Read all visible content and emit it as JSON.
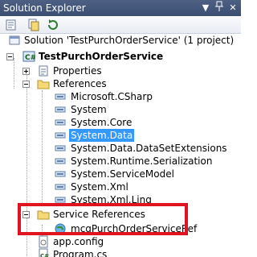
{
  "panel": {
    "title": "Solution Explorer",
    "dropdown_glyph": "▼",
    "pin_glyph": "📌",
    "close_glyph": "✕"
  },
  "toolbar": {
    "buttons": [
      "properties-icon",
      "show-all-files-icon",
      "refresh-icon"
    ]
  },
  "tree": {
    "solution": "Solution 'TestPurchOrderService' (1 project)",
    "project": "TestPurchOrderService",
    "properties": "Properties",
    "references": "References",
    "reference_items": [
      "Microsoft.CSharp",
      "System",
      "System.Core",
      "System.Data",
      "System.Data.DataSetExtensions",
      "System.Runtime.Serialization",
      "System.ServiceModel",
      "System.Xml",
      "System.Xml.Linq"
    ],
    "selected_reference": "System.Data",
    "service_references": "Service References",
    "service_reference_item": "mcgPurchOrderServiceRef",
    "app_config": "app.config",
    "program_cs": "Program.cs"
  },
  "colors": {
    "selection": "#3399ff",
    "highlight_box": "#e0141e",
    "titlebar": "#4d6082"
  }
}
